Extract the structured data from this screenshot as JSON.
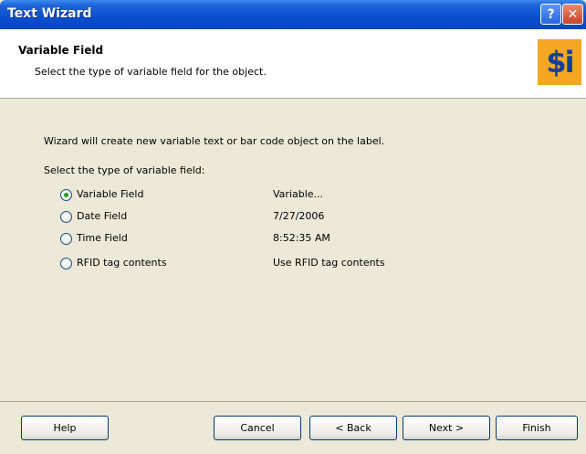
{
  "window": {
    "title": "Text Wizard",
    "help_glyph": "?",
    "close_glyph": "✕"
  },
  "header": {
    "title": "Variable Field",
    "subtitle": "Select the type of variable field for the object.",
    "logo_text": "$i"
  },
  "body": {
    "intro": "Wizard will create new variable text or bar code object on the label.",
    "select_label": "Select the type of variable field:",
    "options": [
      {
        "label": "Variable Field",
        "value": "Variable...",
        "checked": true
      },
      {
        "label": "Date Field",
        "value": "7/27/2006",
        "checked": false
      },
      {
        "label": "Time Field",
        "value": "8:52:35 AM",
        "checked": false
      },
      {
        "label": "RFID tag contents",
        "value": "Use RFID tag contents",
        "checked": false
      }
    ]
  },
  "buttons": {
    "help": "Help",
    "cancel": "Cancel",
    "back": "< Back",
    "next": "Next >",
    "finish": "Finish"
  },
  "colors": {
    "titlebar": "#0a4fd0",
    "dialog_bg": "#ece9d8",
    "header_bg": "#ffffff",
    "logo_bg": "#f5a623",
    "logo_fg": "#1a3d9a",
    "radio_dot": "#21a121"
  },
  "icons": [
    "help-icon",
    "close-icon",
    "app-logo-icon"
  ]
}
